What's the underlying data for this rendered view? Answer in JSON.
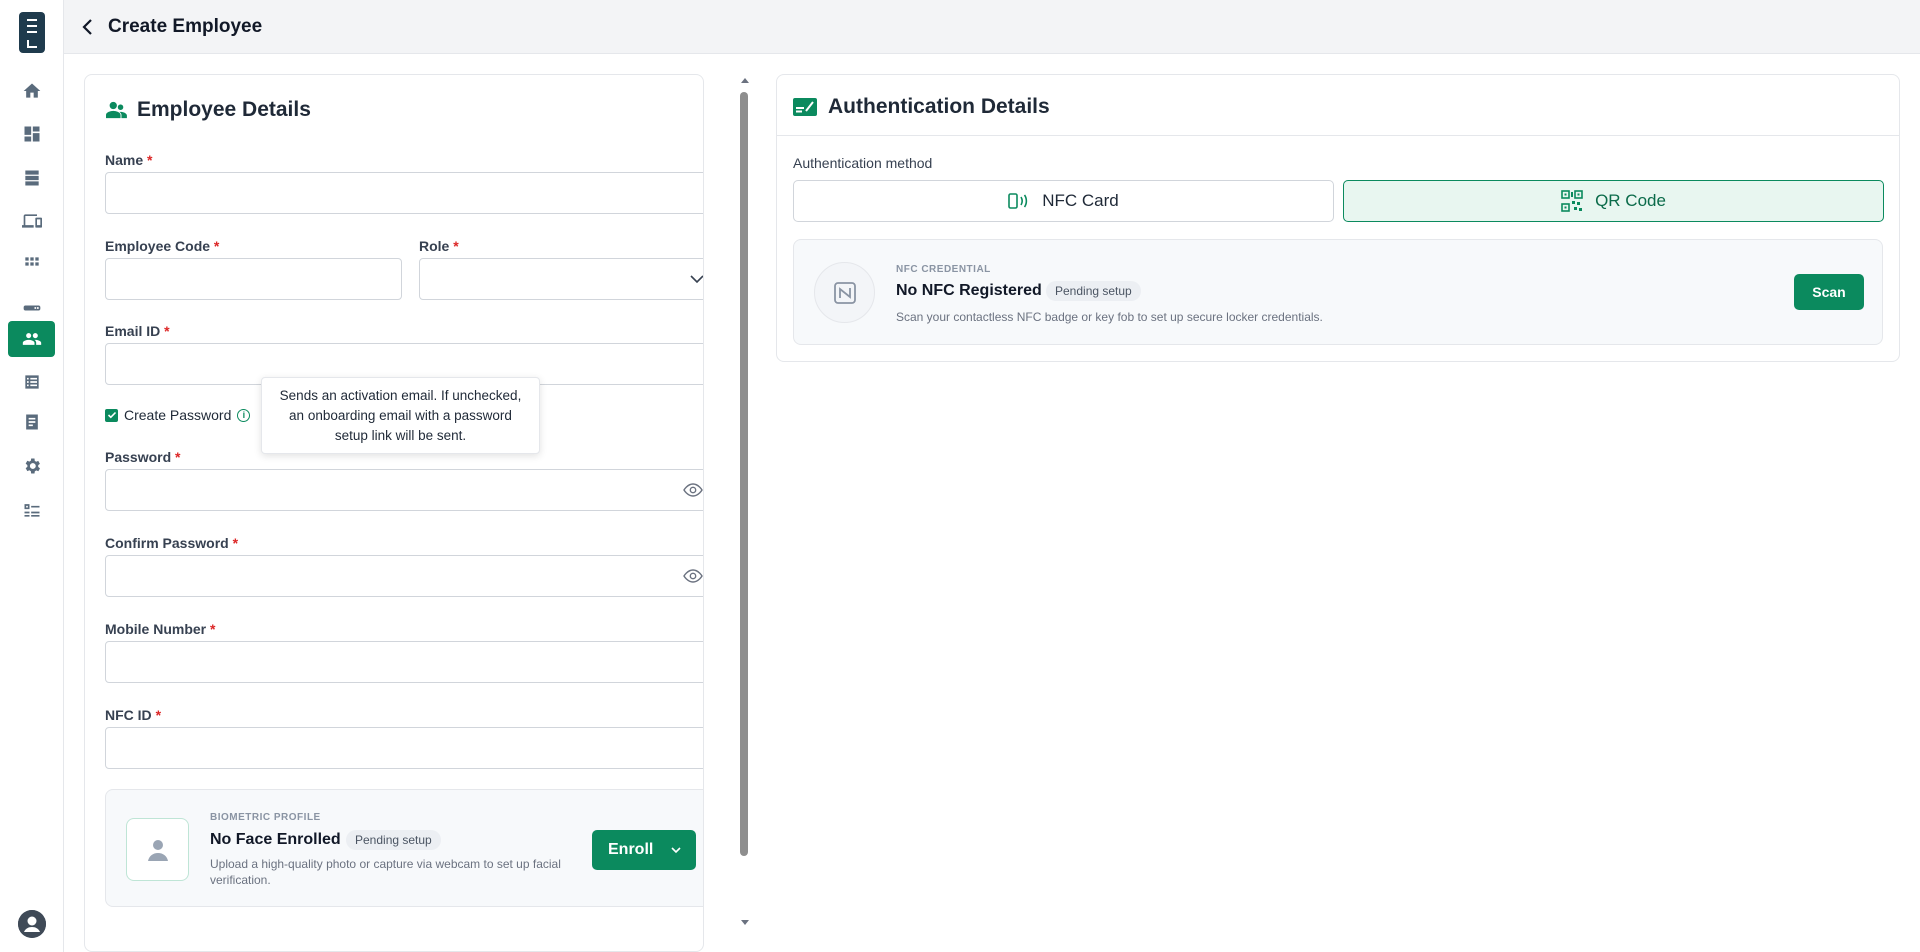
{
  "header": {
    "title": "Create Employee"
  },
  "sidebar": {
    "items": [
      {
        "icon": "home-icon"
      },
      {
        "icon": "dashboard-icon"
      },
      {
        "icon": "storage-icon"
      },
      {
        "icon": "devices-icon"
      },
      {
        "icon": "grid-icon"
      },
      {
        "icon": "card-icon"
      },
      {
        "icon": "people-icon",
        "active": true
      },
      {
        "icon": "list-icon"
      },
      {
        "icon": "document-icon"
      },
      {
        "icon": "settings-icon"
      },
      {
        "icon": "checklist-icon"
      }
    ]
  },
  "employee": {
    "title": "Employee Details",
    "name_label": "Name",
    "code_label": "Employee Code",
    "role_label": "Role",
    "email_label": "Email ID",
    "create_password_label": "Create Password",
    "create_password_checked": true,
    "tooltip": "Sends an activation email. If unchecked, an onboarding email with a password setup link will be sent.",
    "password_label": "Password",
    "confirm_label": "Confirm Password",
    "mobile_label": "Mobile Number",
    "nfc_label": "NFC ID",
    "required_mark": "*",
    "values": {
      "name": "",
      "code": "",
      "role": "",
      "email": "",
      "password": "",
      "confirm": "",
      "mobile": "",
      "nfc": ""
    }
  },
  "biometric": {
    "overline": "BIOMETRIC PROFILE",
    "title": "No Face Enrolled",
    "badge": "Pending setup",
    "desc": "Upload a high-quality photo or capture via webcam to set up facial verification.",
    "button": "Enroll"
  },
  "auth": {
    "title": "Authentication Details",
    "method_label": "Authentication method",
    "methods": [
      {
        "label": "NFC Card",
        "selected": false
      },
      {
        "label": "QR Code",
        "selected": true
      }
    ],
    "nfc": {
      "overline": "NFC CREDENTIAL",
      "title": "No NFC Registered",
      "badge": "Pending setup",
      "desc": "Scan your contactless NFC badge or key fob to set up secure locker credentials.",
      "button": "Scan"
    }
  },
  "colors": {
    "accent": "#0b8a5e",
    "required": "#dc2626"
  }
}
